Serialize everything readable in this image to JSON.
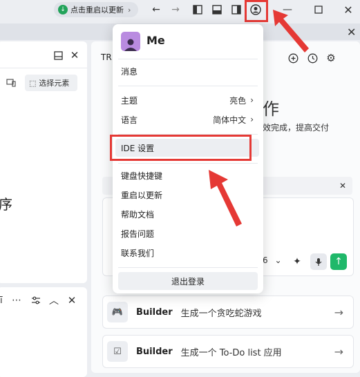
{
  "titlebar": {
    "update_label": "点击重启以更新",
    "back_icon": "arrow-left-icon",
    "forward_icon": "arrow-right-icon",
    "layout_icons": [
      "layout-left-icon",
      "layout-bottom-icon",
      "layout-right-icon"
    ],
    "account_icon": "account-icon",
    "window_buttons": [
      "minimize-icon",
      "maximize-icon",
      "close-icon"
    ]
  },
  "left_panel": {
    "select_element_label": "选择元素",
    "partial_char": "序"
  },
  "right_panel": {
    "tab_prefix": "TR",
    "heading_partial": "作",
    "subtext_partial": "效完成，提高交付",
    "model_version_partial": "6"
  },
  "menu": {
    "username": "Me",
    "items": [
      {
        "label": "消息"
      },
      {
        "label": "主题",
        "value": "亮色"
      },
      {
        "label": "语言",
        "value": "简体中文"
      },
      {
        "label": "IDE 设置"
      },
      {
        "label": "键盘快捷键"
      },
      {
        "label": "重启以更新"
      },
      {
        "label": "帮助文档"
      },
      {
        "label": "报告问题"
      },
      {
        "label": "联系我们"
      }
    ],
    "logout_label": "退出登录"
  },
  "builder_cards": [
    {
      "label": "Builder",
      "desc": "生成一个贪吃蛇游戏"
    },
    {
      "label": "Builder",
      "desc": "生成一个 To-Do list 应用"
    }
  ],
  "colors": {
    "annotation_red": "#e53935",
    "send_green": "#1fb86a",
    "avatar_purple": "#b98be0"
  }
}
